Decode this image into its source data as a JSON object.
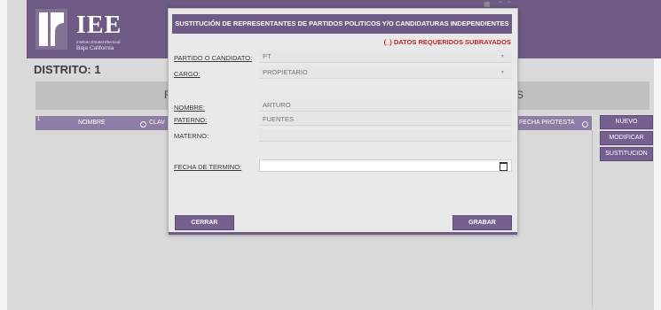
{
  "header": {
    "logo_text": "IEE",
    "logo_subtitle_1": "Instituto Estatal Electoral",
    "logo_subtitle_2": "Baja California"
  },
  "page": {
    "distrito_label": "DISTRITO: 1",
    "graybar_left": "F",
    "graybar_right": "S"
  },
  "table": {
    "col_index": "1",
    "col_nombre": "NOMBRE",
    "col_clave": "CLAV",
    "col_fecha": "FECHA PROTESTA"
  },
  "side_buttons": {
    "nuevo": "NUEVO",
    "modificar": "MODIFICAR",
    "sustitucion": "SUSTITUCION"
  },
  "modal": {
    "title": "SUSTITUCIÓN DE REPRESENTANTES DE PARTIDOS POLITICOS Y/O CANDIDATURAS INDEPENDIENTES",
    "required_note": "(_) DATOS REQUERIDOS SUBRAYADOS",
    "fields": {
      "partido_label": "PARTIDO O CANDIDATO:",
      "partido_value": "PT",
      "cargo_label": "CARGO:",
      "cargo_value": "PROPIETARIO",
      "nombre_label": "NOMBRE:",
      "nombre_value": "ARTURO",
      "paterno_label": "PATERNO:",
      "paterno_value": "FUENTES",
      "materno_label": "MATERNO:",
      "materno_value": "",
      "fecha_label": "FECHA DE TERMINO:",
      "fecha_value": ""
    },
    "cerrar": "CERRAR",
    "grabar": "GRABAR"
  },
  "colors": {
    "brand": "#6e5a84",
    "button": "#76608f",
    "required": "#c62828"
  }
}
